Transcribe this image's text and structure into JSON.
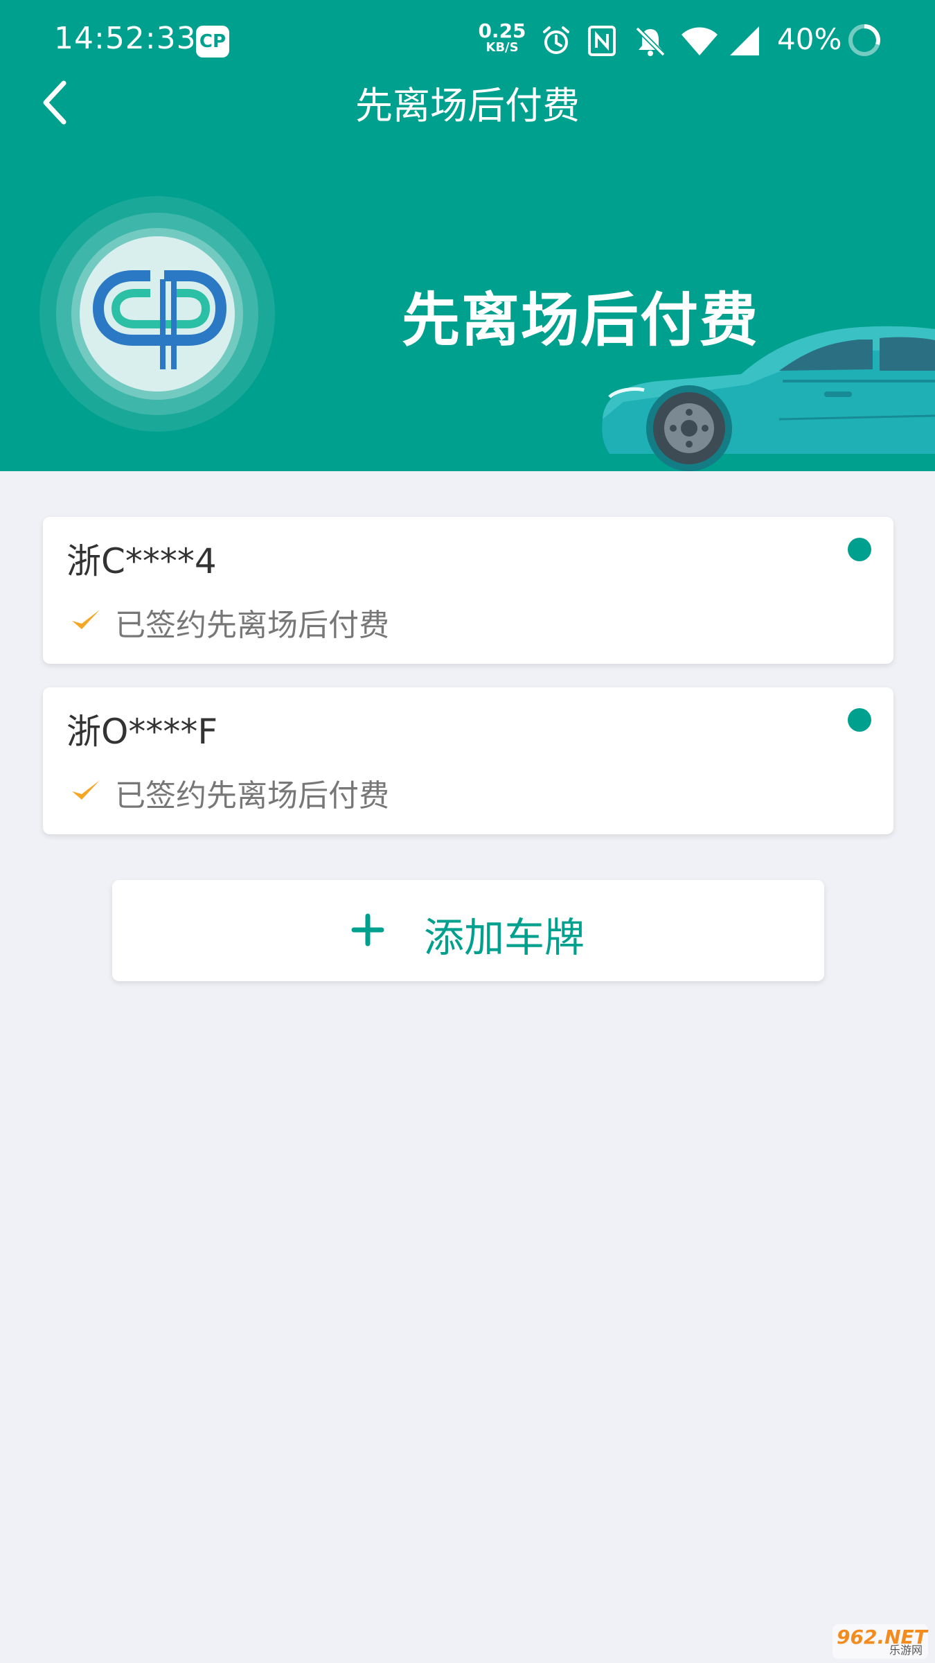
{
  "status_bar": {
    "time": "14:52:33",
    "app_icon_text": "CP",
    "net_speed_value": "0.25",
    "net_speed_unit": "KB/S",
    "battery_percent": "40%",
    "icons": [
      "alarm-icon",
      "nfc-icon",
      "bell-off-icon",
      "wifi-icon",
      "signal-icon",
      "battery-ring-icon"
    ]
  },
  "nav": {
    "back_icon": "chevron-left-icon",
    "title": "先离场后付费"
  },
  "banner": {
    "title": "先离场后付费",
    "logo": "cp-logo",
    "illustration": "car-illustration"
  },
  "plates": [
    {
      "plate": "浙C****4",
      "status": "已签约先离场后付费"
    },
    {
      "plate": "浙O****F",
      "status": "已签约先离场后付费"
    }
  ],
  "add_button": {
    "label": "添加车牌",
    "icon": "plus-icon"
  },
  "watermark": {
    "top": "962.NET",
    "bottom": "乐游网"
  },
  "colors": {
    "primary": "#00a08e",
    "background": "#eff1f6",
    "check": "#f5a623",
    "text_dark": "#333333",
    "text_muted": "#777777"
  }
}
